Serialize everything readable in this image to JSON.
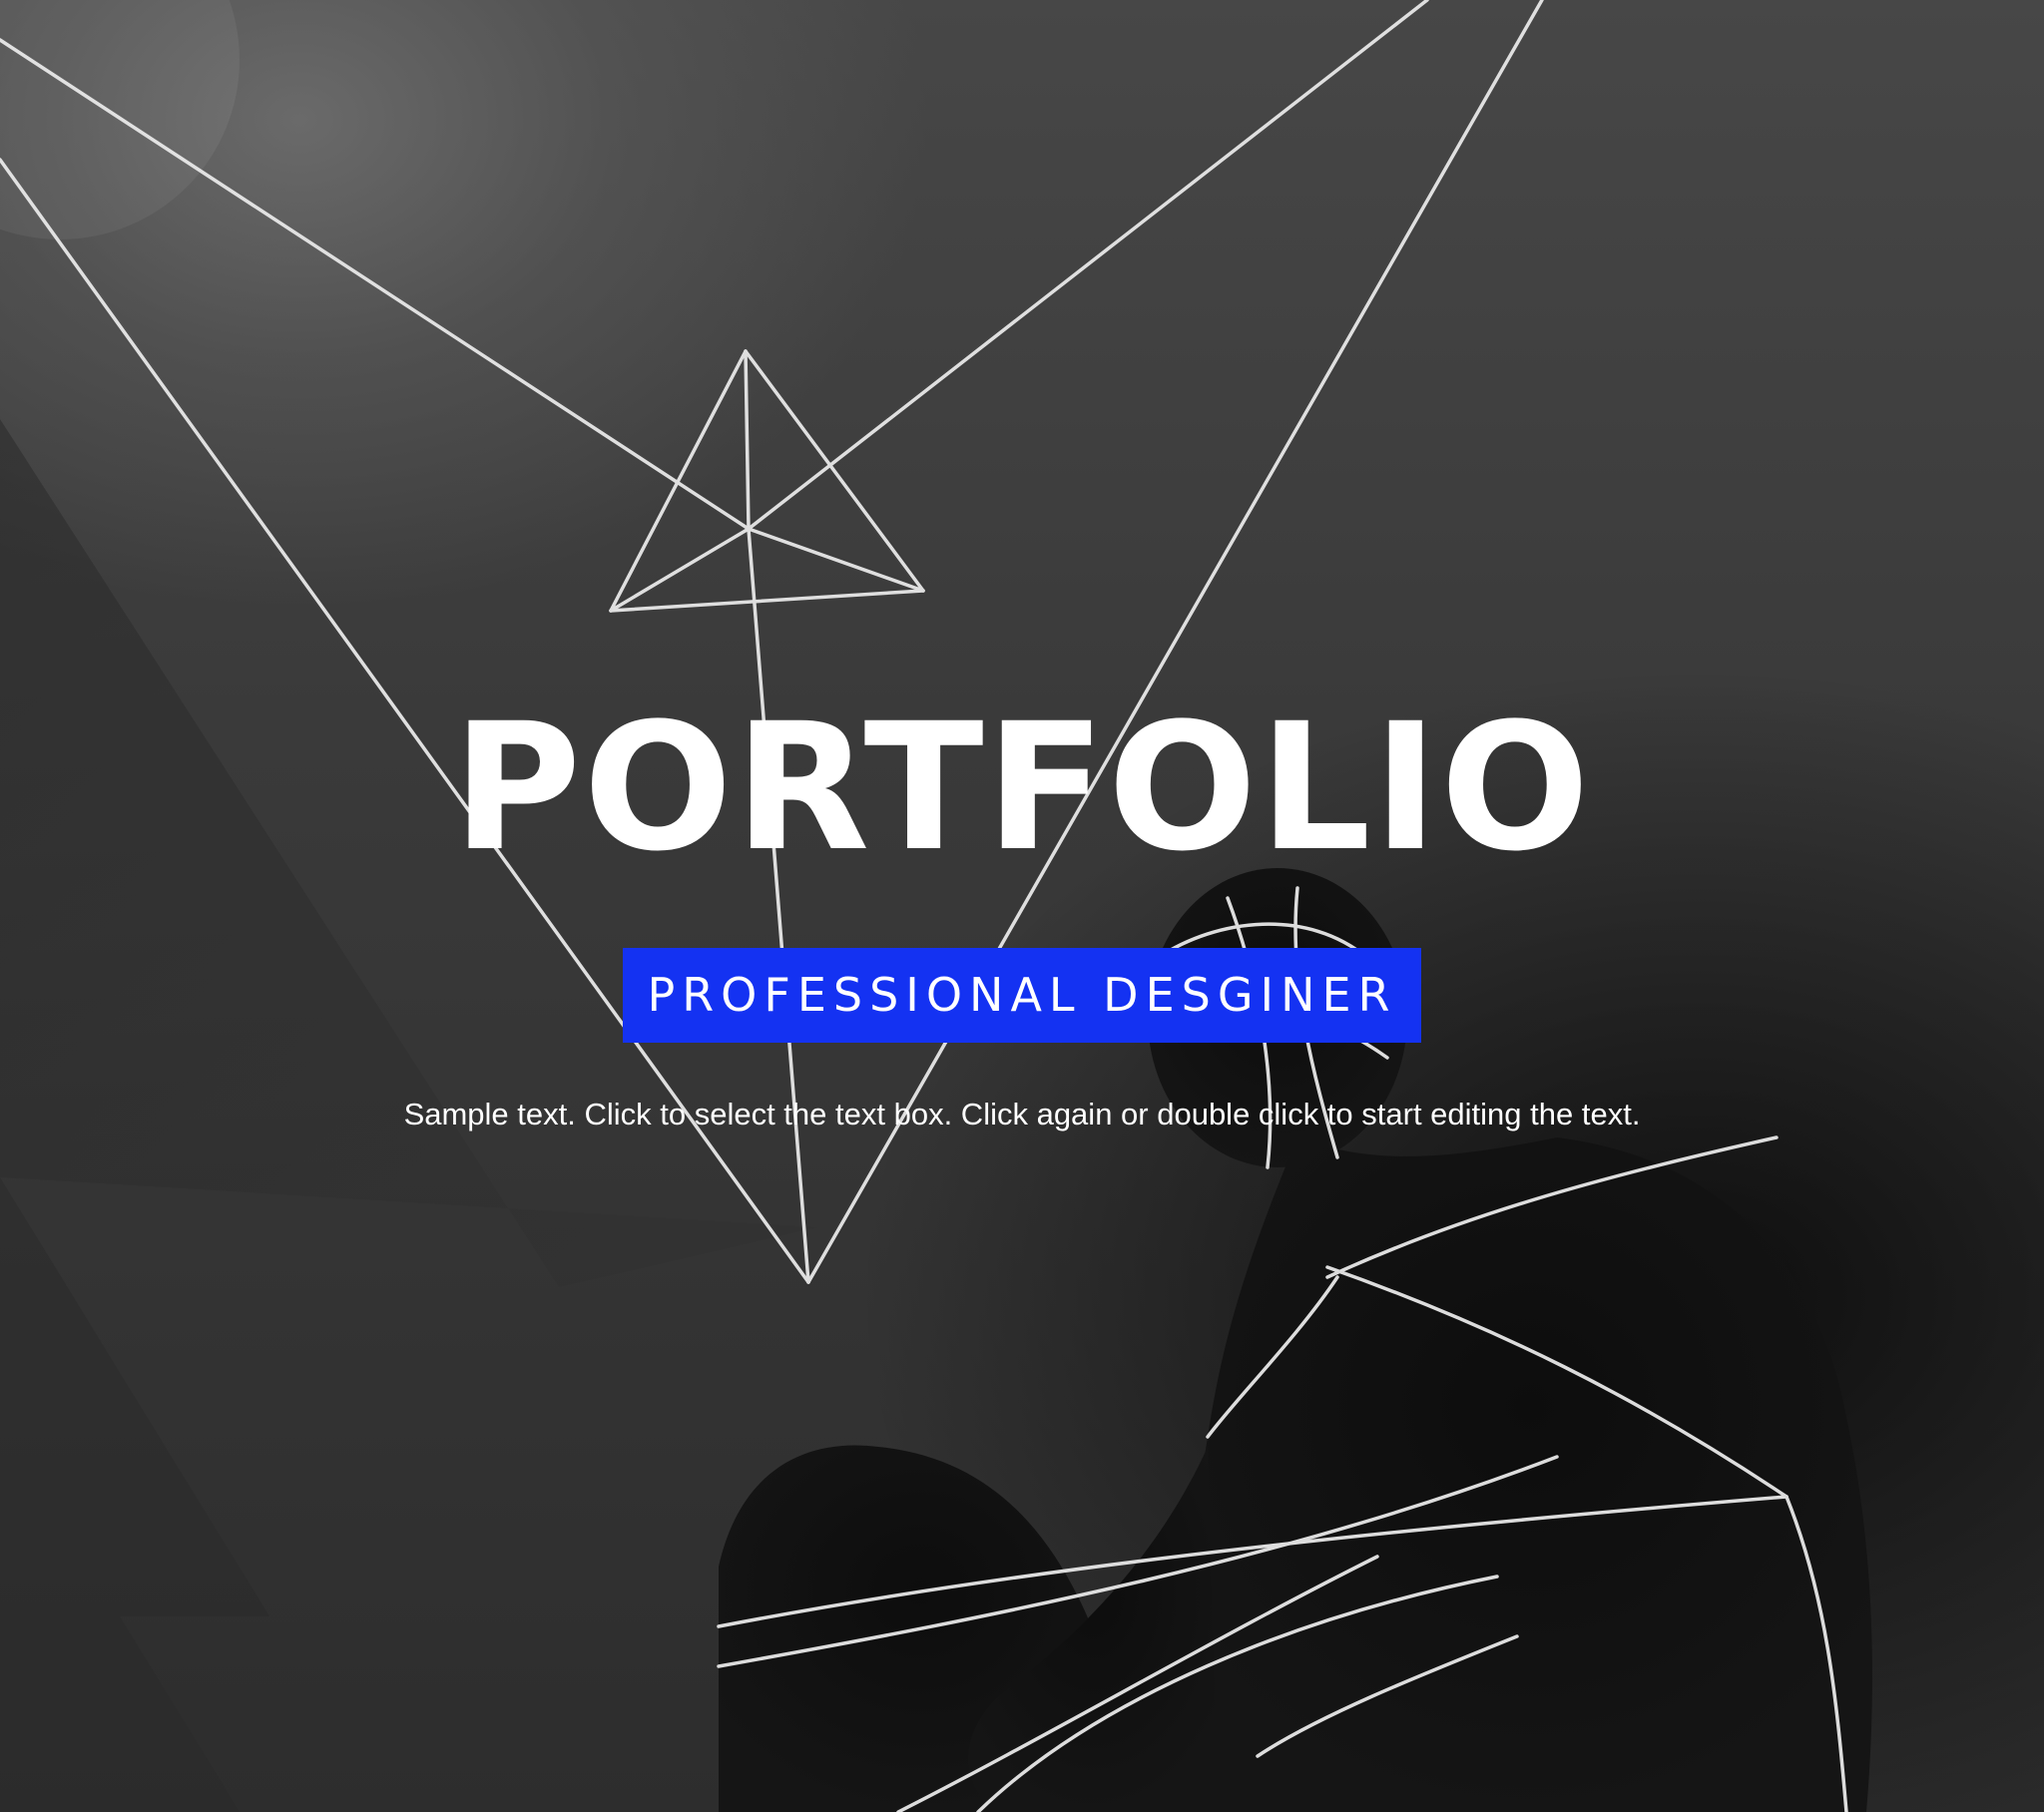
{
  "hero": {
    "title": "PORTFOLIO",
    "tagline": "PROFESSIONAL DESGINER",
    "body_text": "Sample text. Click to select the text box. Click again or double click to start editing the text.",
    "background_image": "black-and-white photo of a person wrapped in white strings forming geometric shapes"
  },
  "colors": {
    "accent": "#1432f2",
    "text": "#ffffff",
    "background": "#3a3a3a"
  }
}
